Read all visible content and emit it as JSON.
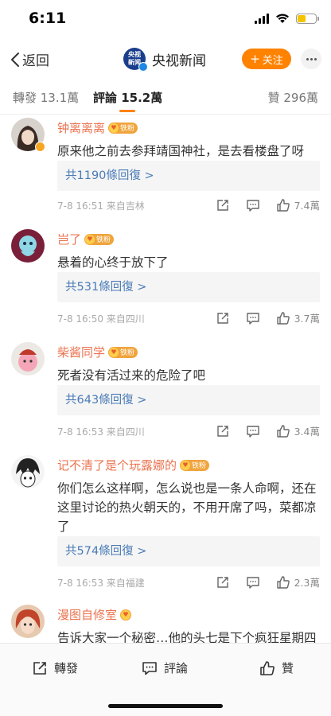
{
  "status_bar": {
    "time": "6:11"
  },
  "nav": {
    "back_label": "返回",
    "avatar_text": "央视新闻",
    "account_name": "央视新闻",
    "follow_label": "关注"
  },
  "tabs": {
    "repost": "轉發 13.1萬",
    "comment": "評論 15.2萬",
    "like": "贊 296萬"
  },
  "comments": [
    {
      "name": "钟离离离",
      "badge": "铁粉",
      "text": "原来他之前去参拜靖国神社，是去看楼盘了呀",
      "replies": "共1190條回復 >",
      "meta": "7-8 16:51  来自吉林",
      "likes": "7.4萬"
    },
    {
      "name": "岂了",
      "badge": "铁粉",
      "text": "悬着的心终于放下了",
      "replies": "共531條回復 >",
      "meta": "7-8 16:50  来自四川",
      "likes": "3.7萬"
    },
    {
      "name": "柴酱同学",
      "badge": "铁粉",
      "text": "死者没有活过来的危险了吧",
      "replies": "共643條回復 >",
      "meta": "7-8 16:53  来自四川",
      "likes": "3.4萬"
    },
    {
      "name": "记不清了是个玩露娜的",
      "badge": "铁粉",
      "text": "你们怎么这样啊，怎么说也是一条人命啊，还在这里讨论的热火朝天的，不用开席了吗，菜都凉了",
      "replies": "共574條回復 >",
      "meta": "7-8 16:53  来自福建",
      "likes": "2.3萬"
    },
    {
      "name": "漫图自修室",
      "badge": "",
      "text": "告诉大家一个秘密…他的头七是下个疯狂星期四",
      "replies": "",
      "meta": "",
      "likes": ""
    }
  ],
  "toolbar": {
    "repost": "轉發",
    "comment": "評論",
    "like": "贊"
  },
  "colors": {
    "accent": "#ff8200",
    "username": "#eb7350",
    "link": "#4a7bb7"
  }
}
